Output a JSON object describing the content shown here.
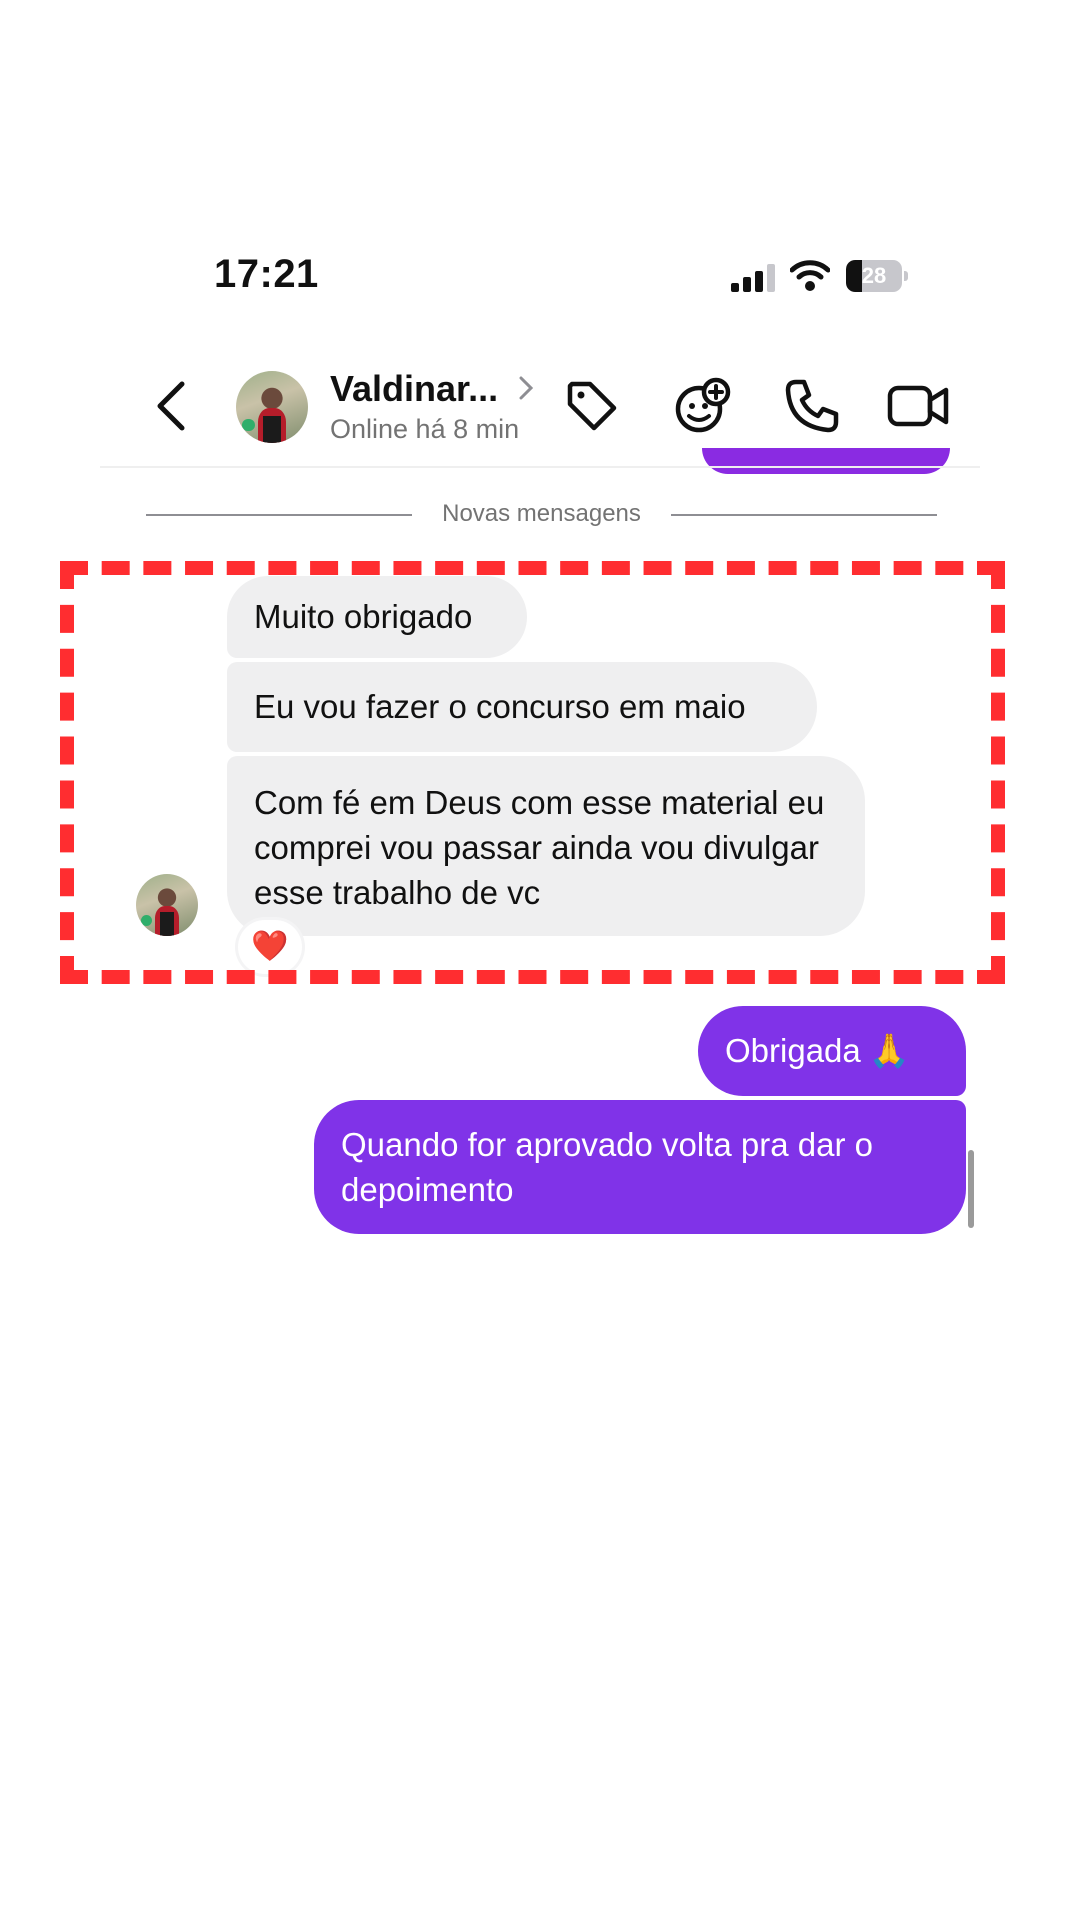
{
  "status_bar": {
    "time": "17:21",
    "battery_level": "28",
    "icons": [
      "signal-icon",
      "wifi-icon",
      "battery-icon"
    ]
  },
  "header": {
    "contact_name": "Valdinar...",
    "contact_status": "Online há 8 min",
    "icons": [
      "back-icon",
      "tag-icon",
      "sticker-add-icon",
      "phone-icon",
      "video-camera-icon"
    ]
  },
  "separator": {
    "label": "Novas mensagens"
  },
  "messages": {
    "received": [
      {
        "text": "Muito obrigado"
      },
      {
        "text": "Eu vou fazer o concurso em maio"
      },
      {
        "text": "Com fé em Deus com esse material eu comprei vou passar ainda vou divulgar esse trabalho de vc",
        "reaction": "❤️"
      }
    ],
    "sent": [
      {
        "text": "Obrigada",
        "emoji": "🙏"
      },
      {
        "text": "Quando for aprovado volta pra dar o depoimento"
      }
    ]
  },
  "colors": {
    "sent_bubble": "#8033e8",
    "received_bubble": "#efeff0",
    "highlight_border": "#ff2d30",
    "previous_bubble": "#8a2be2"
  }
}
